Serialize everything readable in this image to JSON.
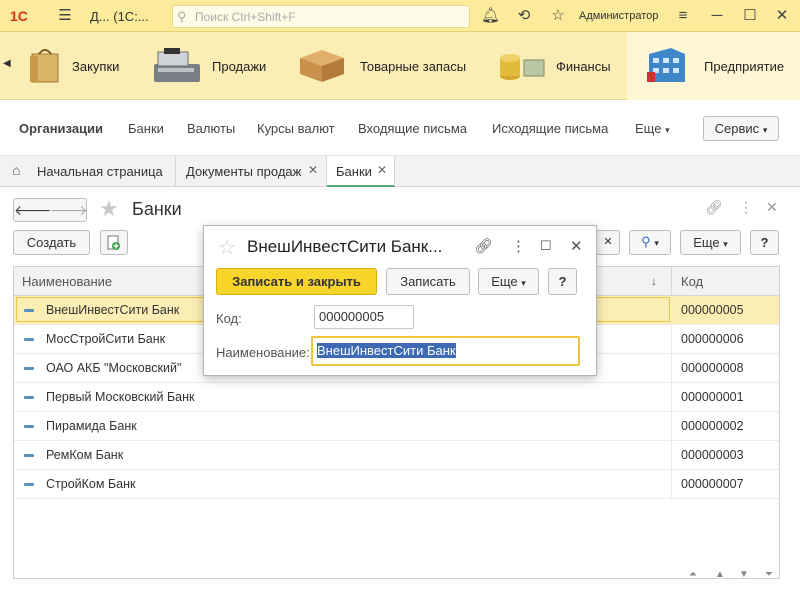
{
  "app": {
    "title": "Д...  (1С:...",
    "search_placeholder": "Поиск Ctrl+Shift+F",
    "user": "Администратор"
  },
  "sections": [
    {
      "label": "Закупки"
    },
    {
      "label": "Продажи"
    },
    {
      "label": "Товарные запасы"
    },
    {
      "label": "Финансы"
    },
    {
      "label": "Предприятие"
    }
  ],
  "function_panel": {
    "items": [
      "Организации",
      "Банки",
      "Валюты",
      "Курсы валют",
      "Входящие письма",
      "Исходящие письма"
    ],
    "more": "Еще",
    "service": "Сервис"
  },
  "tabs": [
    {
      "label": "Начальная страница"
    },
    {
      "label": "Документы продаж"
    },
    {
      "label": "Банки"
    }
  ],
  "form": {
    "title": "Банки",
    "create_label": "Создать",
    "more_label": "Еще",
    "help_label": "?",
    "columns": {
      "name": "Наименование",
      "code": "Код"
    },
    "rows": [
      {
        "name": "ВнешИнвестСити Банк",
        "code": "000000005"
      },
      {
        "name": "МосСтройСити Банк",
        "code": "000000006"
      },
      {
        "name": "ОАО АКБ \"Московский\"",
        "code": "000000008"
      },
      {
        "name": "Первый Московский Банк",
        "code": "000000001"
      },
      {
        "name": "Пирамида Банк",
        "code": "000000002"
      },
      {
        "name": "РемКом Банк",
        "code": "000000003"
      },
      {
        "name": "СтройКом Банк",
        "code": "000000007"
      }
    ]
  },
  "modal": {
    "title": "ВнешИнвестСити Банк...",
    "save_close": "Записать и закрыть",
    "save": "Записать",
    "more": "Еще",
    "help": "?",
    "code_label": "Код:",
    "code_value": "000000005",
    "name_label": "Наименование:",
    "name_value": "ВнешИнвестСити Банк"
  },
  "colors": {
    "title_bar": "#fbeb9a",
    "sections_bg": "#fbeeb4",
    "primary_button": "#f7d52a",
    "selection_highlight": "#3d69b5"
  }
}
